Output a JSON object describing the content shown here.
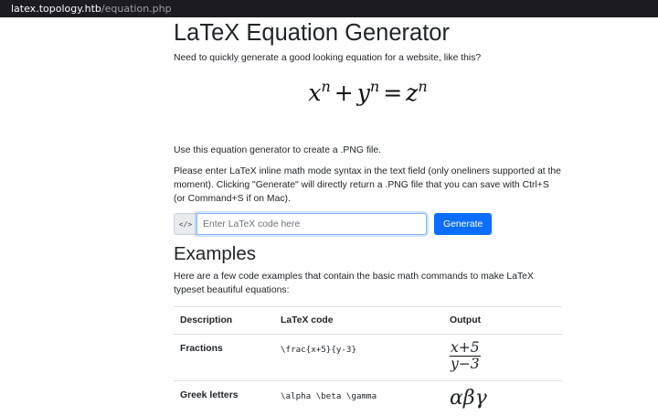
{
  "browser": {
    "url_host": "latex.topology.htb",
    "url_path": "/equation.php"
  },
  "page": {
    "title": "LaTeX Equation Generator",
    "intro": "Need to quickly generate a good looking equation for a website, like this?",
    "hero_equation": {
      "x": "x",
      "n1": "n",
      "plus": "+",
      "y": "y",
      "n2": "n",
      "eq": "=",
      "z": "z",
      "n3": "n"
    },
    "use_line": "Use this equation generator to create a .PNG file.",
    "instructions": "Please enter LaTeX inline math mode syntax in the text field (only oneliners supported at the moment). Clicking \"Generate\" will directly return a .PNG file that you can save with Ctrl+S (or Command+S if on Mac).",
    "form": {
      "addon_icon": "code-icon",
      "addon_glyph": "</>",
      "input_value": "",
      "input_placeholder": "Enter LaTeX code here",
      "generate_label": "Generate",
      "accent_color": "#0d6efd"
    },
    "examples": {
      "heading": "Examples",
      "intro": "Here are a few code examples that contain the basic math commands to make LaTeX typeset beautiful equations:",
      "columns": [
        "Description",
        "LaTeX code",
        "Output"
      ],
      "rows": [
        {
          "description": "Fractions",
          "code": "\\frac{x+5}{y-3}",
          "output": {
            "numerator": "x+5",
            "denominator": "y−3"
          }
        },
        {
          "description": "Greek letters",
          "code": "\\alpha \\beta \\gamma",
          "output": {
            "text": "αβγ"
          }
        }
      ]
    }
  }
}
